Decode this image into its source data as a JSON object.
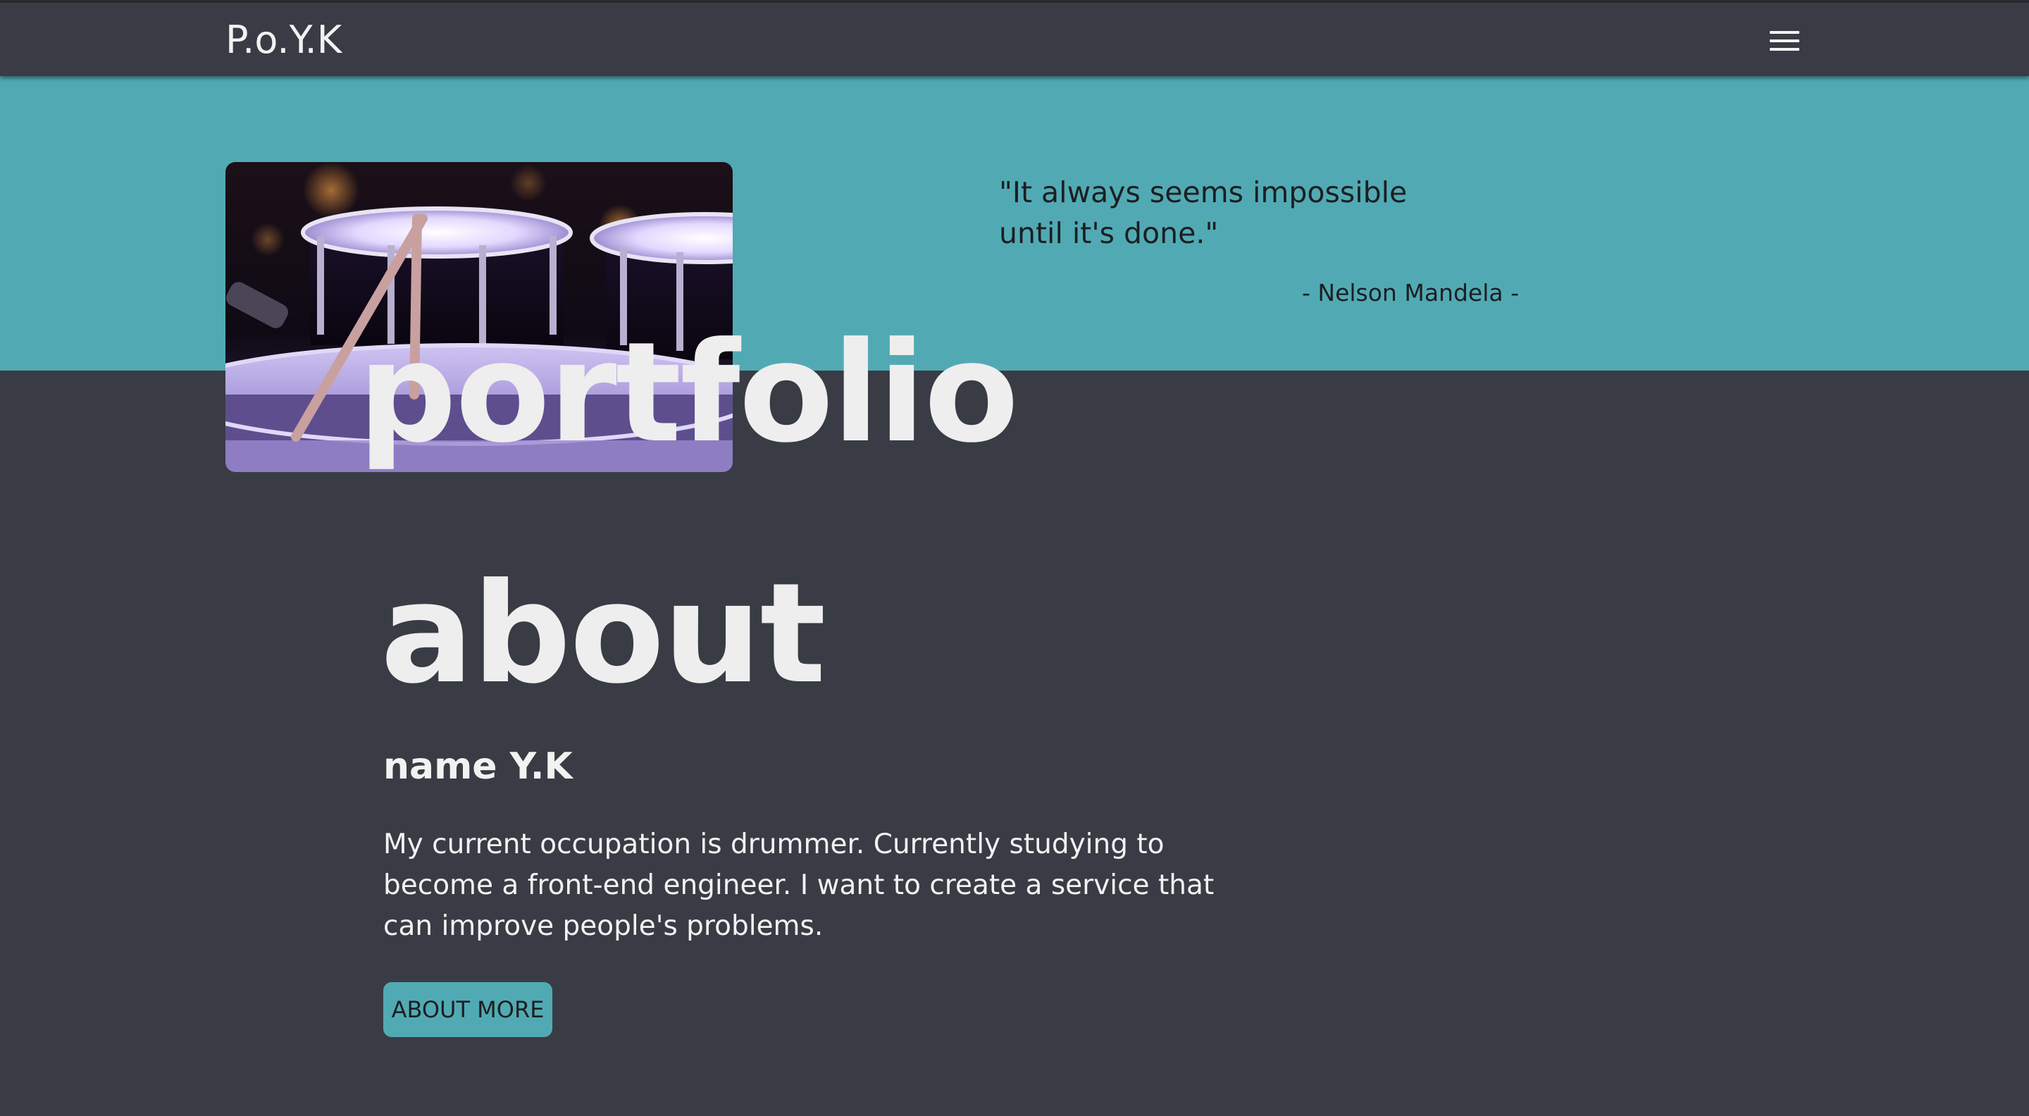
{
  "navbar": {
    "brand": "P.o.Y.K",
    "menu_icon": "hamburger-menu-icon"
  },
  "hero": {
    "image_subject": "drum-kit-with-drumsticks",
    "title": "portfolio",
    "quote": "\"It always seems impossible until it's done.\"",
    "quote_author": "- Nelson Mandela -"
  },
  "about": {
    "title": "about",
    "name": "name Y.K",
    "text": "My current occupation is drummer. Currently studying to become a front-end engineer. I want to create a service that can improve people's problems.",
    "button_label": "ABOUT MORE"
  },
  "colors": {
    "background": "#393c44",
    "accent": "#51aab3",
    "text_light": "#f2f2f2",
    "text_dark": "#1c1e22"
  }
}
